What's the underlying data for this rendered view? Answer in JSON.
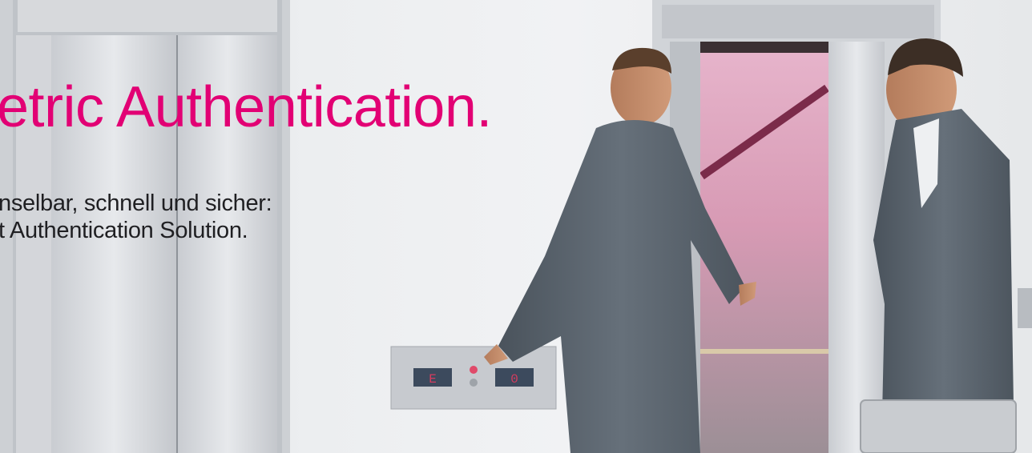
{
  "banner": {
    "headline": "etric Authentication.",
    "subline": [
      "nselbar, schnell und sicher:",
      "t Authentication Solution."
    ]
  },
  "colors": {
    "accent_magenta": "#e20074",
    "wall": "#eceef0",
    "steel": "#b9bdc3",
    "suit": "#5b646e"
  },
  "elevator_panel": {
    "left_display": "E",
    "right_display": "0"
  }
}
